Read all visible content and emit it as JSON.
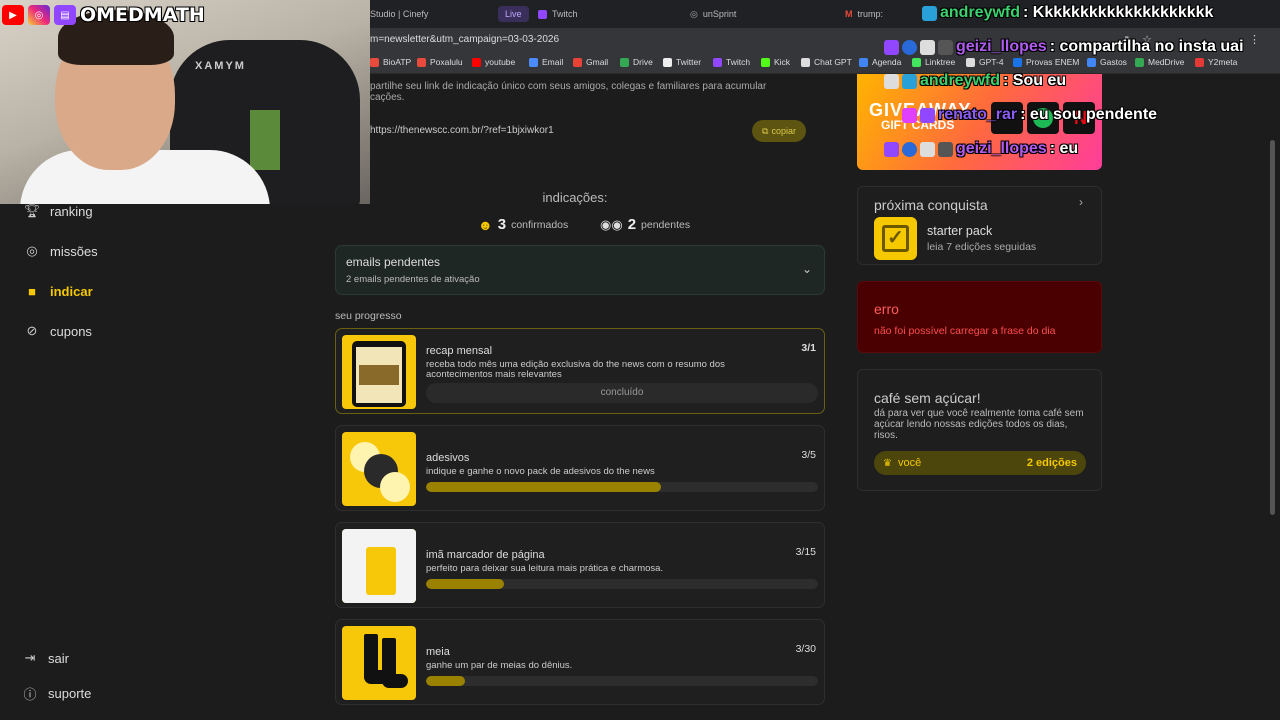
{
  "browser": {
    "tabs": [
      {
        "label": "Studio | Cinefy"
      },
      {
        "label": "Live"
      },
      {
        "label": "Twitch"
      },
      {
        "label": "unSprint"
      },
      {
        "label": "trump:"
      }
    ],
    "url": "m=newsletter&utm_campaign=03-03-2026",
    "bookmarks": [
      "BioATP",
      "Poxalulu",
      "youtube",
      "Email",
      "Gmail",
      "Drive",
      "Twitter",
      "Twitch",
      "Kick",
      "Chat GPT",
      "Agenda",
      "Linktree",
      "GPT-4",
      "Provas ENEM",
      "Gastos",
      "MedDrive",
      "Y2meta"
    ]
  },
  "overlay": {
    "brand": "OMEDMATH",
    "chair_text": "XAMYM"
  },
  "chat": [
    {
      "user": "andreywfd",
      "msg": ": Kkkkkkkkkkkkkkkkkkkk",
      "color": "#3bd16f"
    },
    {
      "user": "geizi_llopes",
      "msg": " : compartilha no insta uai",
      "color": "#b05cf0"
    },
    {
      "user": "andreywfd",
      "msg": " : Sou eu",
      "color": "#3bd16f"
    },
    {
      "user": "renato_rar",
      "msg": " : eu sou pendente",
      "color": "#8b5cf6"
    },
    {
      "user": "geizi_llopes",
      "msg": " : eu",
      "color": "#b05cf0"
    }
  ],
  "sidebar": {
    "items": [
      {
        "label": "ranking",
        "icon": "trophy-icon"
      },
      {
        "label": "missões",
        "icon": "target-icon"
      },
      {
        "label": "indicar",
        "icon": "gift-icon"
      },
      {
        "label": "cupons",
        "icon": "coupon-icon"
      }
    ],
    "logout": "sair",
    "support": "suporte"
  },
  "referral": {
    "text_line1": "partilhe seu link de indicação único com seus amigos, colegas e familiares para acumular",
    "text_line2": "cações.",
    "link": "https://thenewscc.com.br/?ref=1bjxiwkor1",
    "copy_label": "copiar"
  },
  "stats": {
    "title": "indicações:",
    "confirmed_count": "3",
    "confirmed_label": "confirmados",
    "pending_count": "2",
    "pending_label": "pendentes"
  },
  "pending_emails": {
    "title": "emails pendentes",
    "subtitle": "2 emails pendentes de ativação"
  },
  "progress": {
    "heading": "seu progresso",
    "items": [
      {
        "title": "recap mensal",
        "desc": "receba todo mês uma edição exclusiva do the news com o resumo dos acontecimentos mais relevantes",
        "count": "3/1",
        "status": "concluído",
        "fraction": 1.0
      },
      {
        "title": "adesivos",
        "desc": "indique e ganhe o novo pack de adesivos do the news",
        "count": "3/5",
        "fraction": 0.6
      },
      {
        "title": "imã marcador de página",
        "desc": "perfeito para deixar sua leitura mais prática e charmosa.",
        "count": "3/15",
        "fraction": 0.2
      },
      {
        "title": "meia",
        "desc": "ganhe um par de meias do dênius.",
        "count": "3/30",
        "fraction": 0.1
      }
    ]
  },
  "right": {
    "giveaway_title": "GIVEAWAY",
    "giveaway_sub": "GIFT CARDS",
    "next": {
      "title": "próxima conquista",
      "badge_title": "starter pack",
      "badge_desc": "leia 7 edições seguidas"
    },
    "error": {
      "title": "erro",
      "desc": "não foi possível carregar a frase do dia"
    },
    "cafe": {
      "title": "café sem açúcar!",
      "desc": "dá para ver que você realmente toma café sem açúcar lendo nossas edições todos os dias, risos.",
      "user_label": "você",
      "user_value": "2 edições"
    }
  },
  "colors": {
    "accent": "#f5c800",
    "error_bg": "#4a0000",
    "error_text": "#ff4d4d"
  }
}
